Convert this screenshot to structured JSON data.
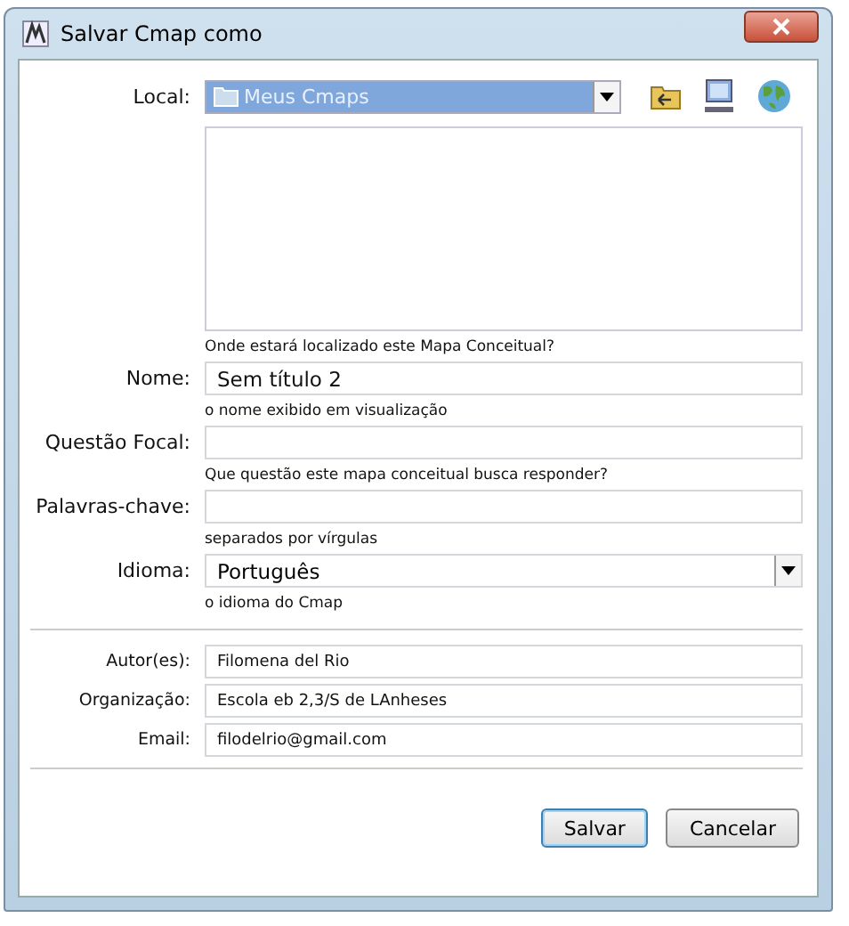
{
  "window": {
    "title": "Salvar Cmap como"
  },
  "location": {
    "label": "Local:",
    "value": "Meus Cmaps",
    "hint": "Onde estará localizado este Mapa Conceitual?"
  },
  "fields": [
    {
      "kind": "text",
      "label": "Nome:",
      "value": "Sem título 2",
      "hint": "o nome exibido em visualização"
    },
    {
      "kind": "text",
      "label": "Questão Focal:",
      "hint": "Que questão este mapa conceitual busca responder?"
    },
    {
      "kind": "text",
      "label": "Palavras-chave:",
      "hint": "separados por vírgulas"
    },
    {
      "kind": "dropdown",
      "label": "Idioma:",
      "value": "Português",
      "hint": "o idioma do Cmap"
    }
  ],
  "author_fields": [
    {
      "label": "Autor(es):",
      "value": "Filomena del Rio"
    },
    {
      "label": "Organização:",
      "value": "Escola eb 2,3/S de LAnheses"
    },
    {
      "label": "Email:",
      "value": "filodelrio@gmail.com"
    }
  ],
  "buttons": [
    {
      "label": "Salvar",
      "default": true
    },
    {
      "label": "Cancelar",
      "default": false
    }
  ]
}
